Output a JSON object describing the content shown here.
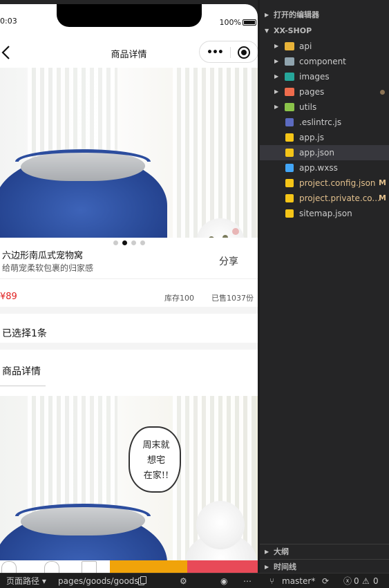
{
  "simulator": {
    "status": {
      "time": "0:03",
      "battery": "100%"
    },
    "nav": {
      "title": "商品详情",
      "capsule_dots": "•••"
    },
    "swiper": {
      "dot_count": 4,
      "active_index": 1
    },
    "goods": {
      "title": "六边形南瓜式宠物窝",
      "subtitle": "给萌宠柔软包裹的归家感",
      "share": "分享",
      "price": "¥89",
      "stock": "库存100",
      "sold": "已售1037份"
    },
    "selected": "已选择1条",
    "detail_title": "商品详情",
    "detail_bubble": "周末就\n想宅\n在家!!"
  },
  "explorer": {
    "open_editors": "打开的编辑器",
    "project": "XX-SHOP",
    "items": [
      {
        "label": "api",
        "type": "folder",
        "icon": "folder-api-icon",
        "color": "#e8b339"
      },
      {
        "label": "component",
        "type": "folder",
        "icon": "folder-component-icon",
        "color": "#90a4ae"
      },
      {
        "label": "images",
        "type": "folder",
        "icon": "folder-images-icon",
        "color": "#26a69a"
      },
      {
        "label": "pages",
        "type": "folder",
        "icon": "folder-pages-icon",
        "color": "#ef6c4d",
        "modified": true
      },
      {
        "label": "utils",
        "type": "folder",
        "icon": "folder-utils-icon",
        "color": "#8bc34a"
      },
      {
        "label": ".eslintrc.js",
        "type": "file",
        "icon": "eslint-icon",
        "color": "#5c6bc0"
      },
      {
        "label": "app.js",
        "type": "file",
        "icon": "js-icon",
        "color": "#f5c518"
      },
      {
        "label": "app.json",
        "type": "file",
        "icon": "json-icon",
        "color": "#f5c518",
        "selected": true
      },
      {
        "label": "app.wxss",
        "type": "file",
        "icon": "css-icon",
        "color": "#42a5f5"
      },
      {
        "label": "project.config.json",
        "type": "file",
        "icon": "json-icon",
        "color": "#f5c518",
        "badge": "M"
      },
      {
        "label": "project.private.co...",
        "type": "file",
        "icon": "json-icon",
        "color": "#f5c518",
        "badge": "M"
      },
      {
        "label": "sitemap.json",
        "type": "file",
        "icon": "json-icon",
        "color": "#f5c518"
      }
    ],
    "outline": "大纲",
    "timeline": "时间线"
  },
  "statusbar": {
    "path_label": "页面路径 ▾",
    "path": "pages/goods/goods",
    "branch": "master*",
    "errors": "0",
    "warnings": "0"
  }
}
